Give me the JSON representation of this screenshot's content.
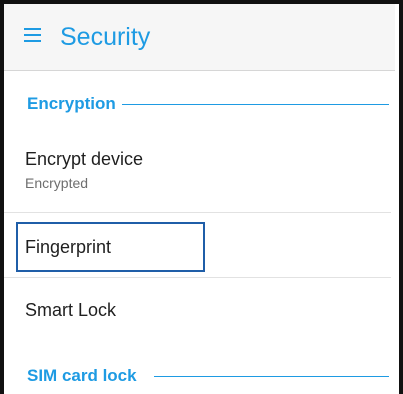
{
  "appbar": {
    "menu_icon": "hamburger-menu-icon",
    "title": "Security"
  },
  "sections": {
    "encryption": {
      "label": "Encryption"
    },
    "sim_card_lock": {
      "label": "SIM card lock"
    }
  },
  "items": {
    "encrypt_device": {
      "title": "Encrypt device",
      "subtitle": "Encrypted"
    },
    "fingerprint": {
      "title": "Fingerprint"
    },
    "smart_lock": {
      "title": "Smart Lock"
    }
  },
  "colors": {
    "accent": "#1e9be3",
    "focus_border": "#1f5ea8"
  }
}
